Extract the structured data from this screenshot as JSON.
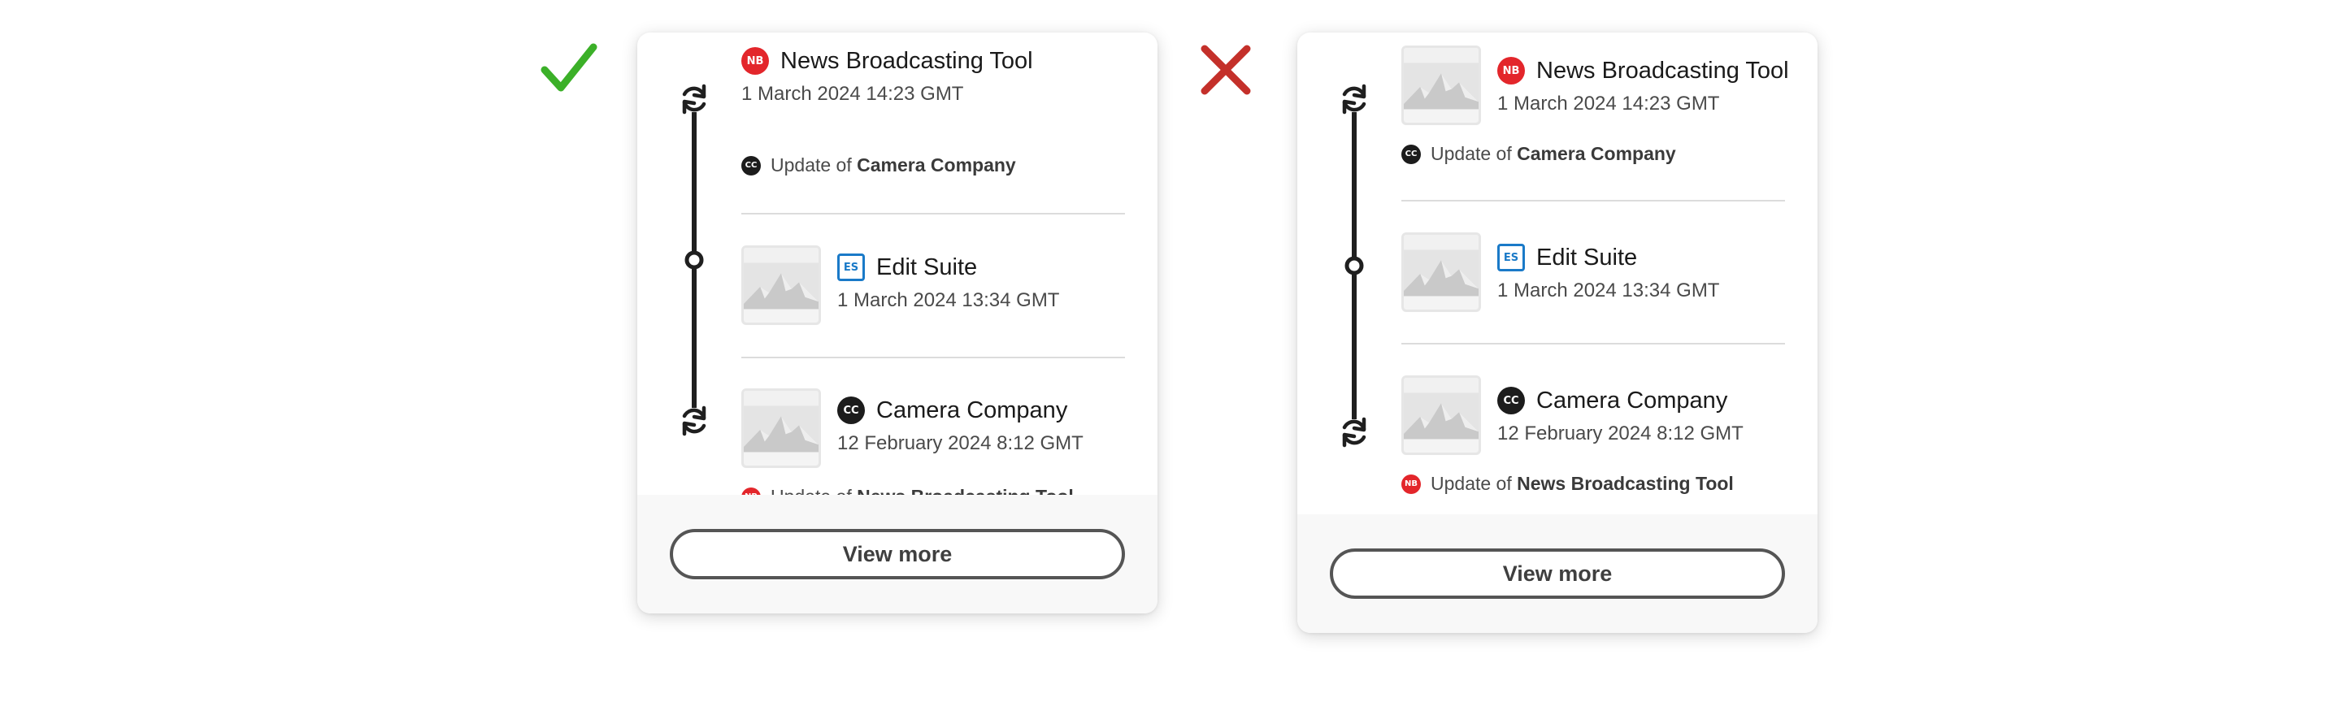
{
  "colors": {
    "good": "#3bb028",
    "bad": "#c4302a",
    "nb_brand": "#e3262b",
    "es_brand": "#1a7ac8",
    "cc_brand": "#1c1c1c"
  },
  "indicators": {
    "good_icon": "check-mark-icon",
    "bad_icon": "cross-mark-icon"
  },
  "cards": [
    {
      "entries": [
        {
          "badge": "NB",
          "title": "News Broadcasting Tool",
          "date": "1 March 2024 14:23 GMT",
          "sub_badge": "CC",
          "sub_prefix": "Update of",
          "sub_target": "Camera Company"
        },
        {
          "badge": "ES",
          "title": "Edit Suite",
          "date": "1 March 2024 13:34 GMT"
        },
        {
          "badge": "CC",
          "title": "Camera Company",
          "date": "12 February 2024 8:12 GMT",
          "sub_badge": "NB",
          "sub_prefix": "Update of",
          "sub_target": "News Broadcasting Tool"
        }
      ],
      "view_more": "View more"
    },
    {
      "entries": [
        {
          "badge": "NB",
          "title": "News Broadcasting Tool",
          "date": "1 March 2024 14:23 GMT",
          "sub_badge": "CC",
          "sub_prefix": "Update of",
          "sub_target": "Camera Company"
        },
        {
          "badge": "ES",
          "title": "Edit Suite",
          "date": "1 March 2024 13:34 GMT"
        },
        {
          "badge": "CC",
          "title": "Camera Company",
          "date": "12 February 2024 8:12 GMT",
          "sub_badge": "NB",
          "sub_prefix": "Update of",
          "sub_target": "News Broadcasting Tool"
        }
      ],
      "view_more": "View more"
    }
  ]
}
